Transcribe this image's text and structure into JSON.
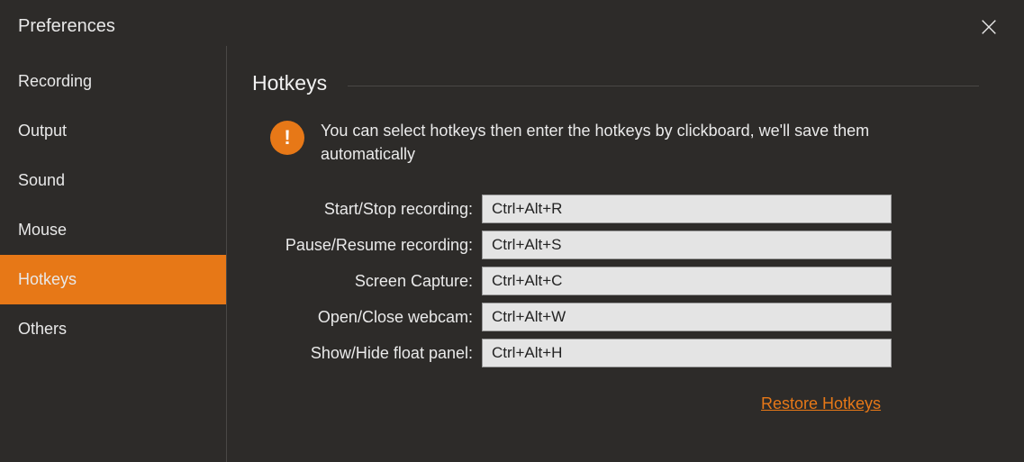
{
  "header": {
    "title": "Preferences"
  },
  "sidebar": {
    "items": [
      {
        "label": "Recording",
        "active": false
      },
      {
        "label": "Output",
        "active": false
      },
      {
        "label": "Sound",
        "active": false
      },
      {
        "label": "Mouse",
        "active": false
      },
      {
        "label": "Hotkeys",
        "active": true
      },
      {
        "label": "Others",
        "active": false
      }
    ]
  },
  "main": {
    "section_title": "Hotkeys",
    "info_text": "You can select hotkeys then enter the hotkeys by clickboard, we'll save them automatically",
    "rows": [
      {
        "label": "Start/Stop recording:",
        "value": "Ctrl+Alt+R"
      },
      {
        "label": "Pause/Resume recording:",
        "value": "Ctrl+Alt+S"
      },
      {
        "label": "Screen Capture:",
        "value": "Ctrl+Alt+C"
      },
      {
        "label": "Open/Close webcam:",
        "value": "Ctrl+Alt+W"
      },
      {
        "label": "Show/Hide float panel:",
        "value": "Ctrl+Alt+H"
      }
    ],
    "restore_label": "Restore Hotkeys"
  }
}
